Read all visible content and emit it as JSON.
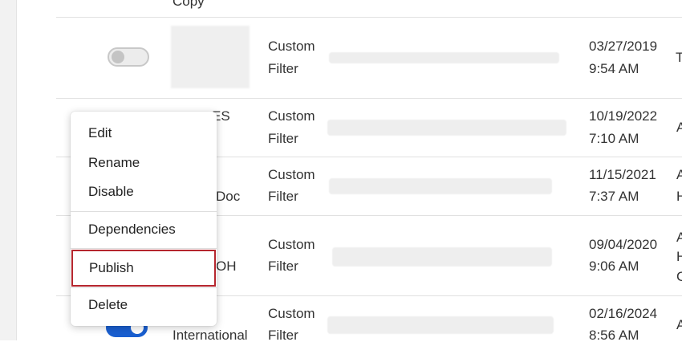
{
  "rows": [
    {
      "name": "Copy",
      "type_line1": "",
      "type_line2": "",
      "date": "",
      "time": "",
      "extra": []
    },
    {
      "name": "",
      "type_line1": "Custom",
      "type_line2": "Filter",
      "date": "03/27/2019",
      "time": "9:54 AM",
      "extra": [
        "T"
      ],
      "toggle": "off"
    },
    {
      "name": "ES",
      "type_line1": "Custom",
      "type_line2": "Filter",
      "date": "10/19/2022",
      "time": "7:10 AM",
      "extra": [
        "A"
      ]
    },
    {
      "name": "Doc",
      "type_line1": "Custom",
      "type_line2": "Filter",
      "date": "11/15/2021",
      "time": "7:37 AM",
      "extra": [
        "A",
        "H"
      ]
    },
    {
      "name": "OH",
      "type_line1": "Custom",
      "type_line2": "Filter",
      "date": "09/04/2020",
      "time": "9:06 AM",
      "extra": [
        "A",
        "H",
        "C"
      ]
    },
    {
      "name": "International",
      "type_line1": "Custom",
      "type_line2": "Filter",
      "date": "02/16/2024",
      "time": "8:56 AM",
      "extra": [
        "A"
      ],
      "toggle": "on"
    }
  ],
  "menu": {
    "items": [
      "Edit",
      "Rename",
      "Disable",
      "Dependencies",
      "Publish",
      "Delete"
    ],
    "highlighted": "Publish"
  },
  "colors": {
    "toggle_on": "#1a5fd0",
    "highlight_border": "#b5262e"
  }
}
